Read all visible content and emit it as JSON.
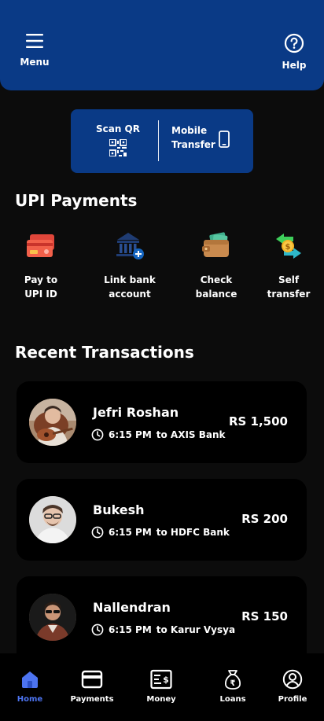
{
  "header": {
    "menu_label": "Menu",
    "help_label": "Help"
  },
  "scan_card": {
    "scan_label": "Scan QR",
    "mobile_line1": "Mobile",
    "mobile_line2": "Transfer"
  },
  "upi": {
    "title": "UPI Payments",
    "items": [
      {
        "line1": "Pay to",
        "line2": "UPI ID",
        "icon": "card-icon"
      },
      {
        "line1": "Link bank",
        "line2": "account",
        "icon": "bank-icon"
      },
      {
        "line1": "Check",
        "line2": "balance",
        "icon": "wallet-icon"
      },
      {
        "line1": "Self",
        "line2": "transfer",
        "icon": "self-transfer-icon"
      }
    ]
  },
  "recent": {
    "title": "Recent Transactions",
    "items": [
      {
        "name": "Jefri Roshan",
        "time": "6:15 PM",
        "dest": "to AXIS Bank",
        "amount": "RS 1,500"
      },
      {
        "name": "Bukesh",
        "time": "6:15 PM",
        "dest": "to HDFC Bank",
        "amount": "RS 200"
      },
      {
        "name": "Nallendran",
        "time": "6:15 PM",
        "dest": "to Karur Vysya",
        "amount": "RS 150"
      }
    ]
  },
  "nav": {
    "items": [
      {
        "label": "Home",
        "icon": "home-icon",
        "active": true
      },
      {
        "label": "Payments",
        "icon": "card-icon"
      },
      {
        "label": "Money",
        "icon": "money-icon"
      },
      {
        "label": "Loans",
        "icon": "loan-bag-icon"
      },
      {
        "label": "Profile",
        "icon": "profile-icon"
      }
    ]
  },
  "colors": {
    "primary": "#0a3a86",
    "background": "#0c0c0c",
    "card": "#000000",
    "active_nav": "#4d74f0"
  }
}
